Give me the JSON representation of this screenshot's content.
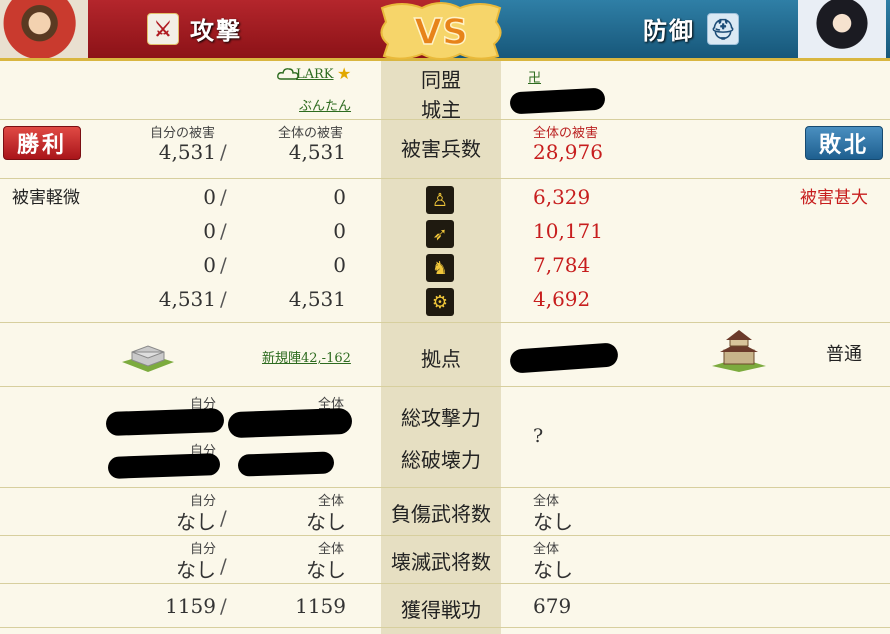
{
  "header": {
    "attack_label": "攻撃",
    "defense_label": "防御",
    "vs_label": "VS",
    "attack_icon": "crossed-swords",
    "defense_icon": "helmet"
  },
  "colors": {
    "attack": "#b4262c",
    "defense": "#2f7fa6",
    "middle_column": "#e6dfc2",
    "damage_red": "#c71e1e"
  },
  "alliance": {
    "label": "同盟",
    "attacker": "LARK",
    "defender": "卍"
  },
  "lord": {
    "label": "城主",
    "attacker": "ぶんたん"
  },
  "damage": {
    "label": "被害兵数",
    "self_caption": "自分の被害",
    "total_caption": "全体の被害",
    "defender_caption": "全体の被害",
    "attacker_self": "4,531",
    "attacker_total": "4,531",
    "defender_total": "28,976",
    "win_label": "勝利",
    "lose_label": "敗北"
  },
  "severity": {
    "attacker": "被害軽微",
    "defender": "被害甚大"
  },
  "units": [
    {
      "icon": "spearman-icon",
      "self": "0",
      "total": "0",
      "defender": "6,329"
    },
    {
      "icon": "archer-icon",
      "self": "0",
      "total": "0",
      "defender": "10,171"
    },
    {
      "icon": "cavalry-icon",
      "self": "0",
      "total": "0",
      "defender": "7,784"
    },
    {
      "icon": "siege-icon",
      "self": "4,531",
      "total": "4,531",
      "defender": "4,692"
    }
  ],
  "base": {
    "label": "拠点",
    "attacker": "新規陣42,-162",
    "defender_status": "普通"
  },
  "power": {
    "attack_label": "総攻撃力",
    "destroy_label": "総破壊力",
    "self_caption": "自分",
    "total_caption": "全体",
    "defender_value": "?"
  },
  "wounded": {
    "label": "負傷武将数",
    "self_caption": "自分",
    "total_caption": "全体",
    "self": "なし",
    "total": "なし",
    "defender_caption": "全体",
    "defender": "なし"
  },
  "destroyed": {
    "label": "壊滅武将数",
    "self_caption": "自分",
    "total_caption": "全体",
    "self": "なし",
    "total": "なし",
    "defender_caption": "全体",
    "defender": "なし"
  },
  "merit": {
    "label": "獲得戦功",
    "self": "1159",
    "total": "1159",
    "defender": "679"
  },
  "slash": "/"
}
